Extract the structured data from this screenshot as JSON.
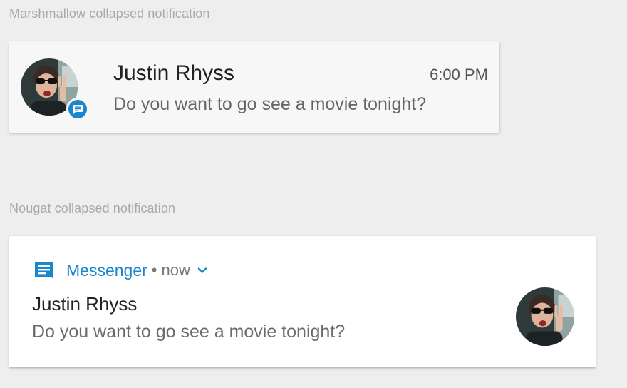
{
  "marshmallow": {
    "section_label": "Marshmallow collapsed notification",
    "title": "Justin Rhyss",
    "time": "6:00 PM",
    "text": "Do you want to go see a movie tonight?",
    "badge_icon": "message-icon"
  },
  "nougat": {
    "section_label": "Nougat collapsed notification",
    "app_name": "Messenger",
    "separator": "•",
    "when": "now",
    "app_icon": "messenger-icon",
    "expand_icon": "chevron-down-icon",
    "title": "Justin Rhyss",
    "text": "Do you want to go see a movie tonight?"
  },
  "colors": {
    "background": "#eeeeee",
    "accent": "#1a86cc",
    "card_marshmallow": "#f7f7f7",
    "card_nougat": "#ffffff",
    "label": "#a9a9a9"
  }
}
